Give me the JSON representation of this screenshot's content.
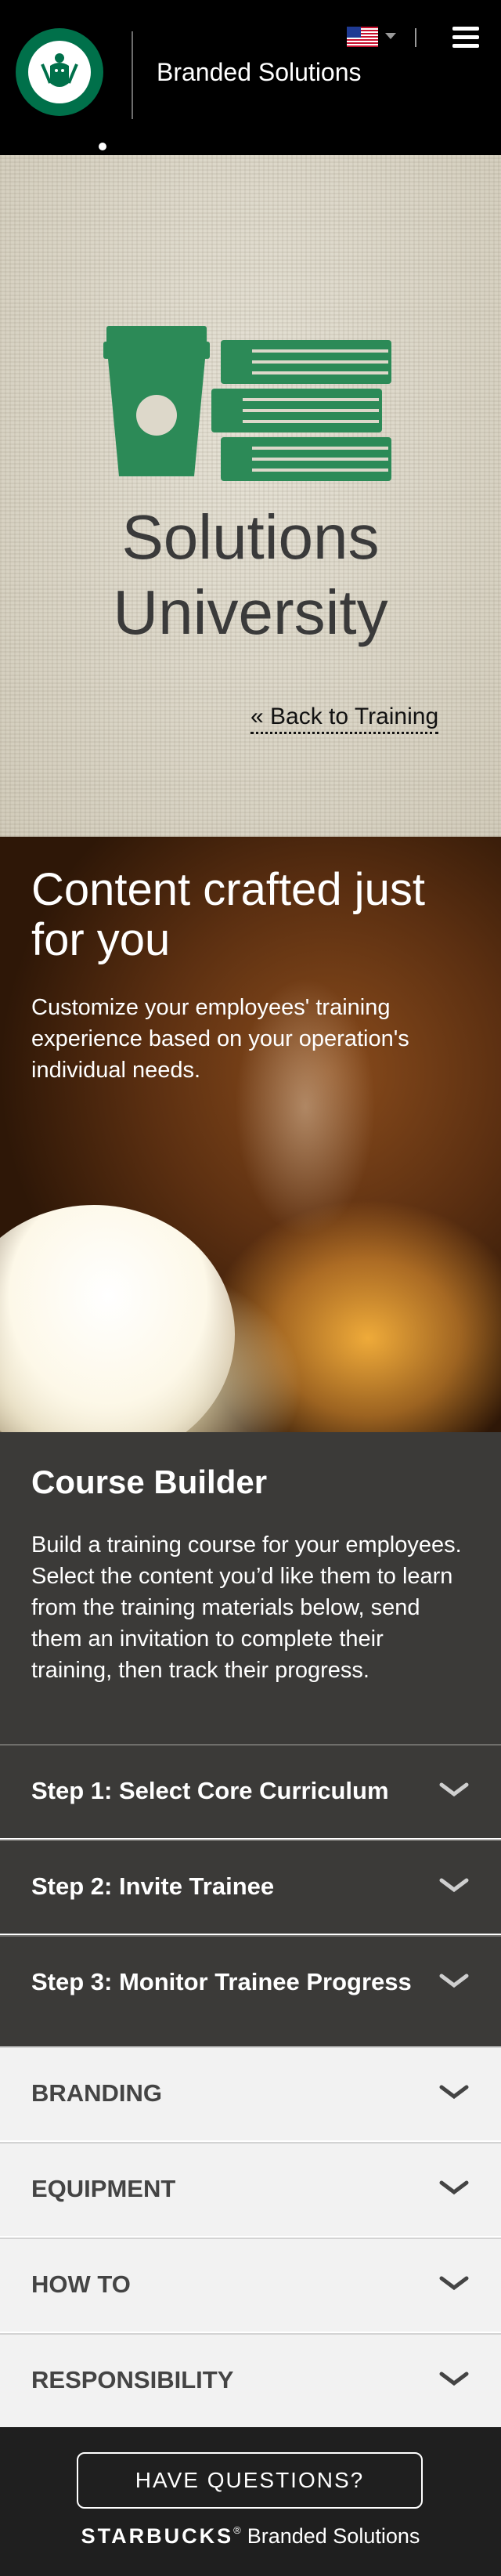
{
  "header": {
    "brand_name": "Branded Solutions",
    "flag": "us-flag-icon",
    "menu_icon": "hamburger-menu-icon"
  },
  "hero": {
    "title": "Solutions University",
    "back_link": "« Back to Training",
    "illustration": "cup-and-books-illustration"
  },
  "promo": {
    "title": "Content crafted just for you",
    "text": "Customize your employees' training experience based on your operation's individual needs."
  },
  "course_builder": {
    "title": "Course Builder",
    "text": "Build a training course for your employees. Select the content you’d like them to learn from the training materials below, send them an invitation to complete their training, then track their progress.",
    "steps": [
      {
        "label": "Step 1: Select Core Curriculum"
      },
      {
        "label": "Step 2: Invite Trainee"
      },
      {
        "label": "Step 3: Monitor Trainee Progress"
      }
    ]
  },
  "categories": [
    {
      "label": "BRANDING"
    },
    {
      "label": "EQUIPMENT"
    },
    {
      "label": "HOW TO"
    },
    {
      "label": "RESPONSIBILITY"
    }
  ],
  "footer": {
    "button": "HAVE QUESTIONS?",
    "brand_word": "STARBUCKS",
    "brand_reg": "®",
    "brand_sub": "Branded Solutions"
  },
  "colors": {
    "header_bg": "#000000",
    "starbucks_green": "#00704a",
    "illustration_green": "#2c8a57",
    "dark_panel": "#3b3a38",
    "light_row": "#f2f2f2",
    "footer_bg": "#1f1f1f"
  }
}
